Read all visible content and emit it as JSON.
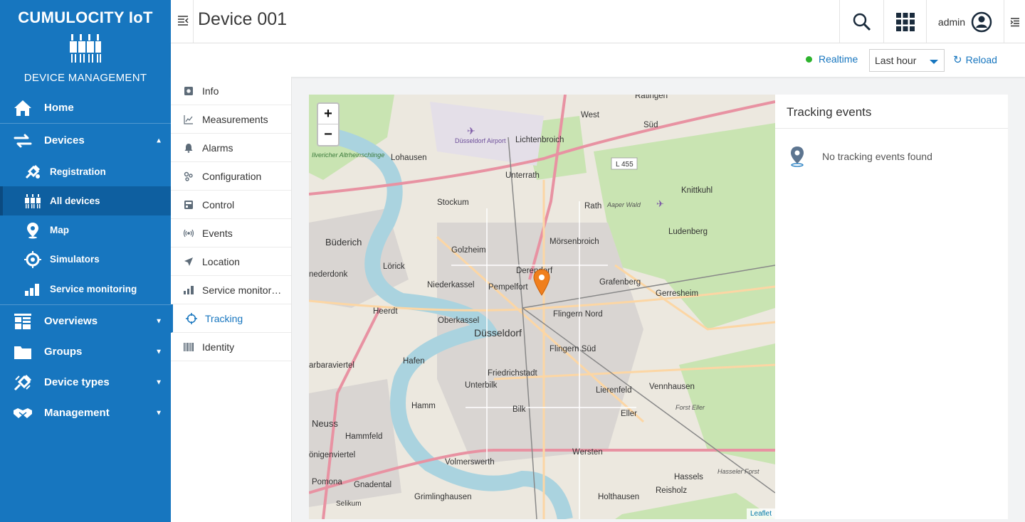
{
  "brand": {
    "title": "CUMULOCITY IoT",
    "subtitle": "DEVICE MANAGEMENT"
  },
  "sidebar": {
    "items": [
      {
        "label": "Home",
        "icon": "home-icon"
      },
      {
        "label": "Devices",
        "icon": "devices-icon",
        "expanded": true
      },
      {
        "label": "Registration",
        "icon": "registration-icon"
      },
      {
        "label": "All devices",
        "icon": "all-devices-icon",
        "active": true
      },
      {
        "label": "Map",
        "icon": "map-pin-icon"
      },
      {
        "label": "Simulators",
        "icon": "simulators-icon"
      },
      {
        "label": "Service monitoring",
        "icon": "bar-chart-icon"
      },
      {
        "label": "Overviews",
        "icon": "dashboard-icon"
      },
      {
        "label": "Groups",
        "icon": "folder-icon"
      },
      {
        "label": "Device types",
        "icon": "device-types-icon"
      },
      {
        "label": "Management",
        "icon": "handshake-icon"
      }
    ]
  },
  "header": {
    "title": "Device 001",
    "user": "admin"
  },
  "actionbar": {
    "realtime": "Realtime",
    "time_range": "Last hour",
    "reload": "Reload"
  },
  "tabs": [
    {
      "label": "Info",
      "icon": "info-icon"
    },
    {
      "label": "Measurements",
      "icon": "line-chart-icon"
    },
    {
      "label": "Alarms",
      "icon": "bell-icon"
    },
    {
      "label": "Configuration",
      "icon": "config-icon"
    },
    {
      "label": "Control",
      "icon": "control-icon"
    },
    {
      "label": "Events",
      "icon": "broadcast-icon"
    },
    {
      "label": "Location",
      "icon": "location-arrow-icon"
    },
    {
      "label": "Service monitoring",
      "icon": "bar-chart-icon"
    },
    {
      "label": "Tracking",
      "icon": "crosshair-icon",
      "active": true
    },
    {
      "label": "Identity",
      "icon": "barcode-icon"
    }
  ],
  "map": {
    "zoom_in": "+",
    "zoom_out": "−",
    "attribution": "Leaflet",
    "places": [
      {
        "name": "Ratingen"
      },
      {
        "name": "West"
      },
      {
        "name": "Süd"
      },
      {
        "name": "Lohausen"
      },
      {
        "name": "Lichtenbroich"
      },
      {
        "name": "Düsseldorf Airport"
      },
      {
        "name": "Unterrath"
      },
      {
        "name": "Stockum"
      },
      {
        "name": "Rath"
      },
      {
        "name": "Knittkuhl"
      },
      {
        "name": "Aaper Wald"
      },
      {
        "name": "Ludenberg"
      },
      {
        "name": "Büderich"
      },
      {
        "name": "Golzheim"
      },
      {
        "name": "Mörsenbroich"
      },
      {
        "name": "Lörick"
      },
      {
        "name": "Derendorf"
      },
      {
        "name": "Pempelfort"
      },
      {
        "name": "Niederkassel"
      },
      {
        "name": "Grafenberg"
      },
      {
        "name": "Gerresheim"
      },
      {
        "name": "Heerdt"
      },
      {
        "name": "Oberkassel"
      },
      {
        "name": "Flingern Nord"
      },
      {
        "name": "Düsseldorf"
      },
      {
        "name": "Flingern Süd"
      },
      {
        "name": "Hafen"
      },
      {
        "name": "Friedrichstadt"
      },
      {
        "name": "Unterbilk"
      },
      {
        "name": "Lierenfeld"
      },
      {
        "name": "Vennhausen"
      },
      {
        "name": "Hamm"
      },
      {
        "name": "Bilk"
      },
      {
        "name": "Eller"
      },
      {
        "name": "Forst Eller"
      },
      {
        "name": "Neuss"
      },
      {
        "name": "Hammfeld"
      },
      {
        "name": "Wersten"
      },
      {
        "name": "Volmerswerth"
      },
      {
        "name": "Hassels"
      },
      {
        "name": "Hasseler Forst"
      },
      {
        "name": "Pomona"
      },
      {
        "name": "Gnadental"
      },
      {
        "name": "Grimlinghausen"
      },
      {
        "name": "Holthausen"
      },
      {
        "name": "Reisholz"
      },
      {
        "name": "Ilvericher Altrheinschlinge"
      },
      {
        "name": "Selikum"
      },
      {
        "name": "nederdonk"
      },
      {
        "name": "arbaraviertel"
      },
      {
        "name": "önigenviertel"
      },
      {
        "name": "L 455"
      }
    ]
  },
  "tracking": {
    "title": "Tracking events",
    "empty_text": "No tracking events found"
  }
}
